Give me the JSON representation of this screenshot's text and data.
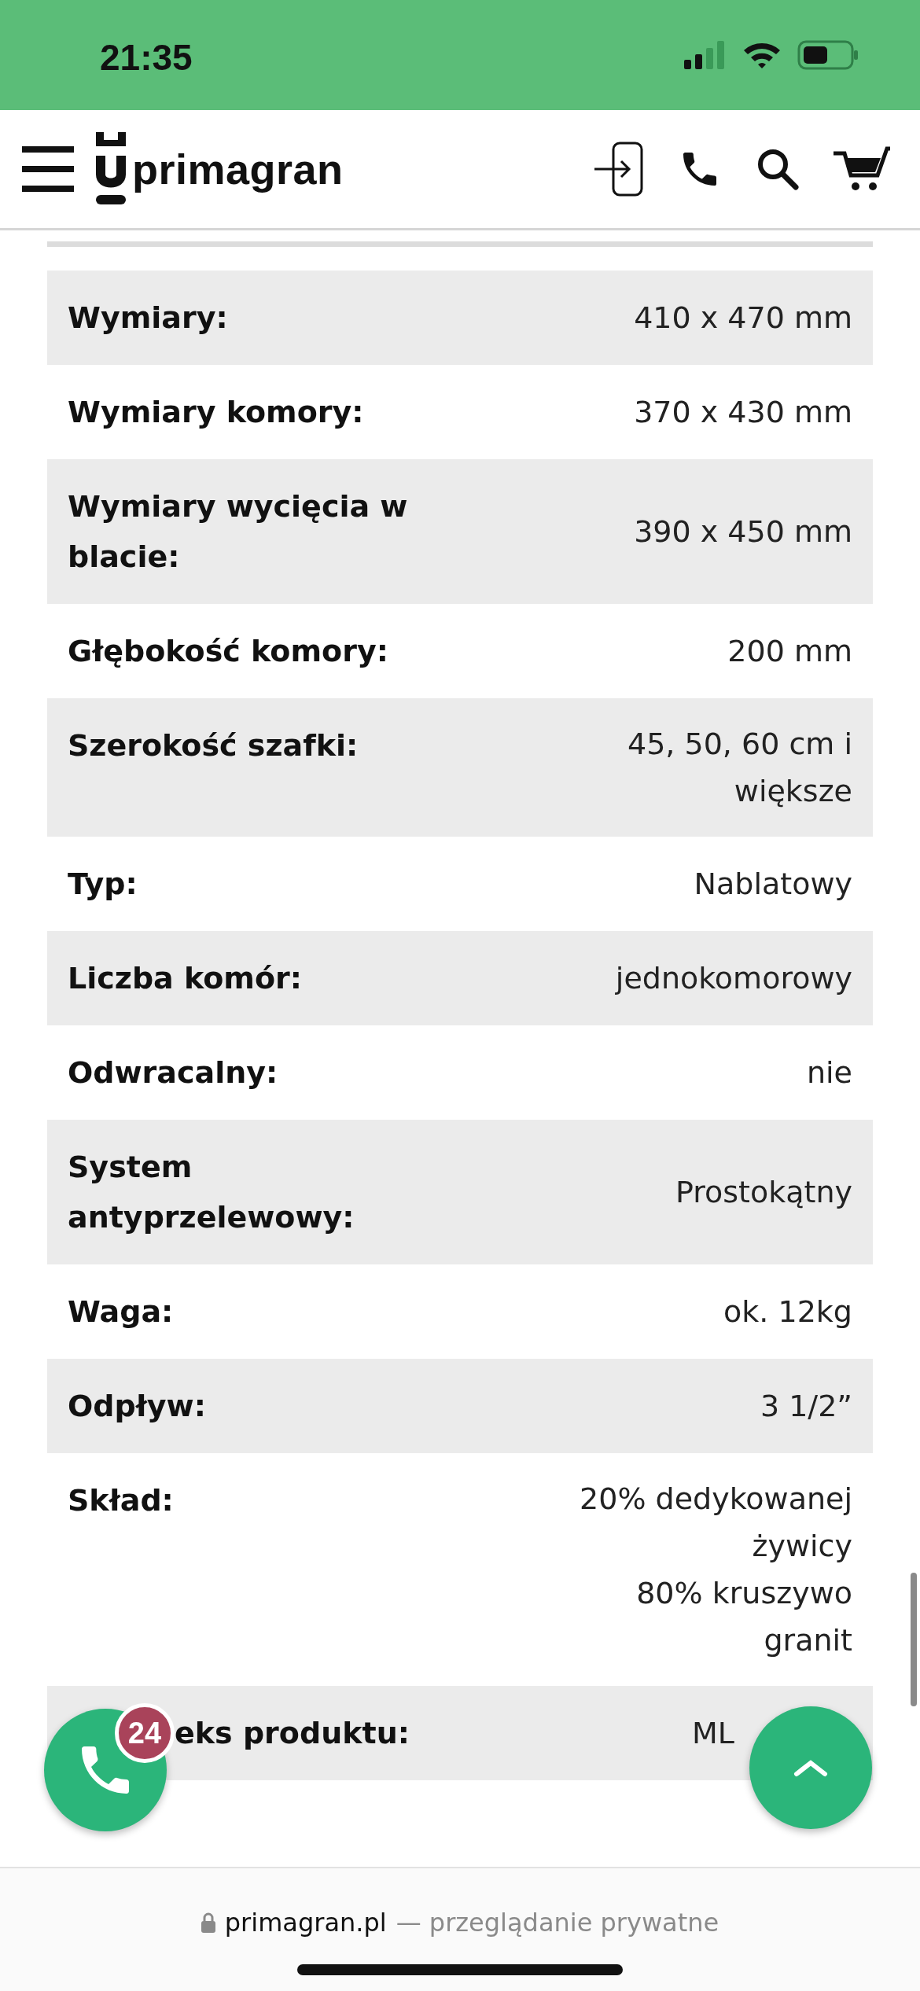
{
  "status_bar": {
    "time": "21:35"
  },
  "header": {
    "logo": "primagran"
  },
  "specs": [
    {
      "label": "Wymiary:",
      "values": [
        "410 x 470 mm"
      ]
    },
    {
      "label": "Wymiary komory:",
      "values": [
        "370 x 430 mm"
      ]
    },
    {
      "label": "Wymiary wycięcia w blacie:",
      "values": [
        "390 x 450 mm"
      ]
    },
    {
      "label": "Głębokość komory:",
      "values": [
        "200 mm"
      ]
    },
    {
      "label": "Szerokość szafki:",
      "values": [
        "45, 50, 60 cm i większe"
      ]
    },
    {
      "label": "Typ:",
      "values": [
        "Nablatowy"
      ]
    },
    {
      "label": "Liczba komór:",
      "values": [
        "jednokomorowy"
      ]
    },
    {
      "label": "Odwracalny:",
      "values": [
        "nie"
      ]
    },
    {
      "label": "System antyprzelewowy:",
      "values": [
        "Prostokątny"
      ]
    },
    {
      "label": "Waga:",
      "values": [
        "ok. 12kg"
      ]
    },
    {
      "label": "Odpływ:",
      "values": [
        "3 1/2”"
      ]
    },
    {
      "label": "Skład:",
      "values": [
        "20% dedykowanej żywicy",
        "80% kruszywo granit"
      ]
    },
    {
      "label": "eks produktu:",
      "values": [
        "ML"
      ],
      "kind": "covered"
    }
  ],
  "call_button": {
    "badge": "24"
  },
  "address_bar": {
    "domain": "primagran.pl",
    "note": "— przeglądanie prywatne"
  }
}
